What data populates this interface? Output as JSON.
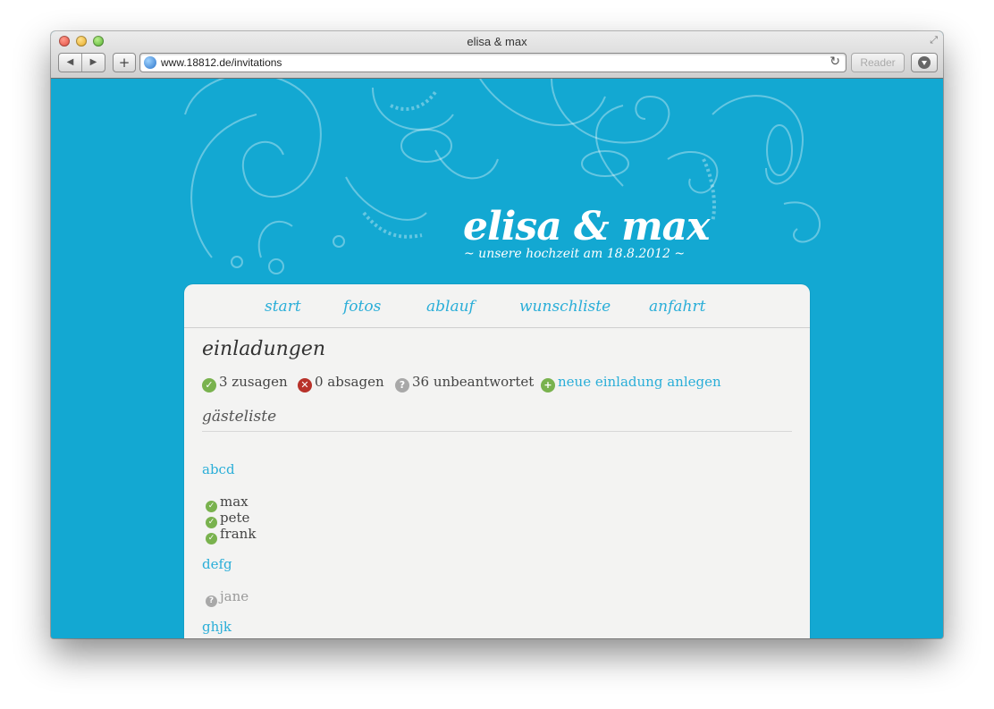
{
  "window": {
    "title": "elisa & max"
  },
  "browser": {
    "url": "www.18812.de/invitations",
    "reader_label": "Reader"
  },
  "site": {
    "title": "elisa & max",
    "subtitle": "~ unsere hochzeit am 18.8.2012 ~"
  },
  "nav": {
    "items": [
      {
        "label": "start"
      },
      {
        "label": "fotos"
      },
      {
        "label": "ablauf"
      },
      {
        "label": "wunschliste"
      },
      {
        "label": "anfahrt"
      }
    ]
  },
  "page": {
    "title": "einladungen",
    "stats": {
      "accepted": "3 zusagen",
      "declined": "0 absagen",
      "unanswered": "36 unbeantwortet",
      "new_invitation": "neue einladung anlegen"
    },
    "guestlist_title": "gästeliste",
    "groups": [
      {
        "name": "abcd",
        "guests": [
          {
            "name": "max",
            "status": "accepted"
          },
          {
            "name": "pete",
            "status": "accepted"
          },
          {
            "name": "frank",
            "status": "accepted"
          }
        ]
      },
      {
        "name": "defg",
        "guests": [
          {
            "name": "jane",
            "status": "pending"
          }
        ]
      },
      {
        "name": "ghjk",
        "guests": []
      }
    ]
  },
  "colors": {
    "background": "#13a8d2",
    "accent": "#2aaed8",
    "accepted": "#79b24e",
    "declined": "#b8322a",
    "pending": "#a8a8a8"
  }
}
